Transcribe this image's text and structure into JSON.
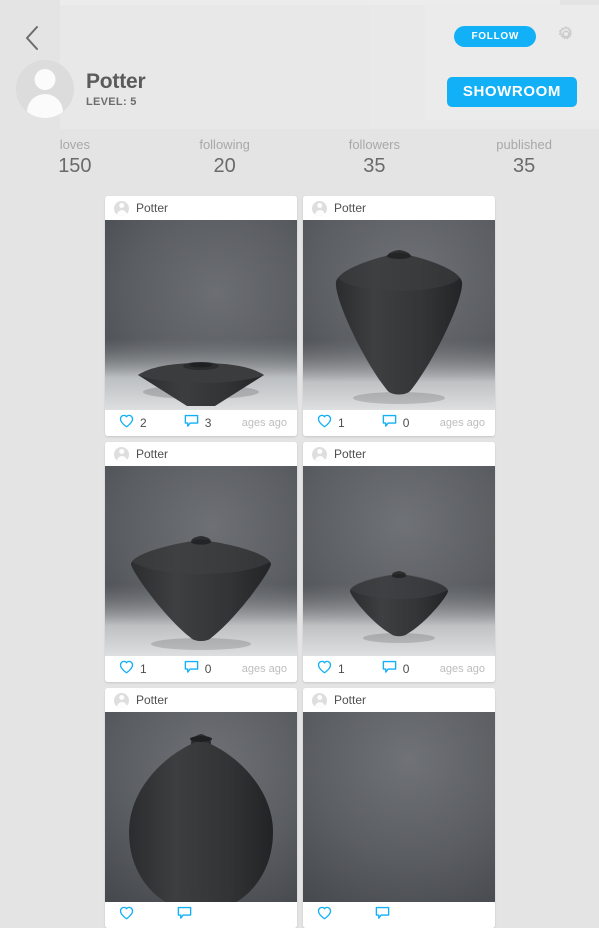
{
  "theme": {
    "background": "#e4e4e4",
    "accent": "#12b0f7",
    "card_background": "#ffffff",
    "text_primary": "#5b5b5b",
    "text_muted": "#a8a8a8"
  },
  "header": {
    "back_icon": "chevron-left-icon",
    "gear_icon": "gear-icon",
    "avatar_icon": "person-avatar-icon",
    "profile_name": "Potter",
    "profile_level": "LEVEL: 5",
    "follow_label": "FOLLOW",
    "showroom_label": "SHOWROOM"
  },
  "stats": [
    {
      "label": "loves",
      "value": "150"
    },
    {
      "label": "following",
      "value": "20"
    },
    {
      "label": "followers",
      "value": "35"
    },
    {
      "label": "published",
      "value": "35"
    }
  ],
  "grid": {
    "love_icon": "heart-outline-icon",
    "comment_icon": "speech-bubble-icon",
    "cards": [
      {
        "user": "Potter",
        "loves": "2",
        "comments": "3",
        "time_ago": "ages ago",
        "photo_alt": "wide-conical-ceramic-vessel"
      },
      {
        "user": "Potter",
        "loves": "1",
        "comments": "0",
        "time_ago": "ages ago",
        "photo_alt": "tall-teardrop-ceramic-vessel"
      },
      {
        "user": "Potter",
        "loves": "1",
        "comments": "0",
        "time_ago": "ages ago",
        "photo_alt": "broad-conical-ceramic-vessel"
      },
      {
        "user": "Potter",
        "loves": "1",
        "comments": "0",
        "time_ago": "ages ago",
        "photo_alt": "small-conical-ceramic-vessel"
      },
      {
        "user": "Potter",
        "loves": "",
        "comments": "",
        "time_ago": "",
        "photo_alt": "round-bellied-ceramic-vessel"
      },
      {
        "user": "Potter",
        "loves": "",
        "comments": "",
        "time_ago": "",
        "photo_alt": "empty-gray-backdrop"
      }
    ]
  }
}
